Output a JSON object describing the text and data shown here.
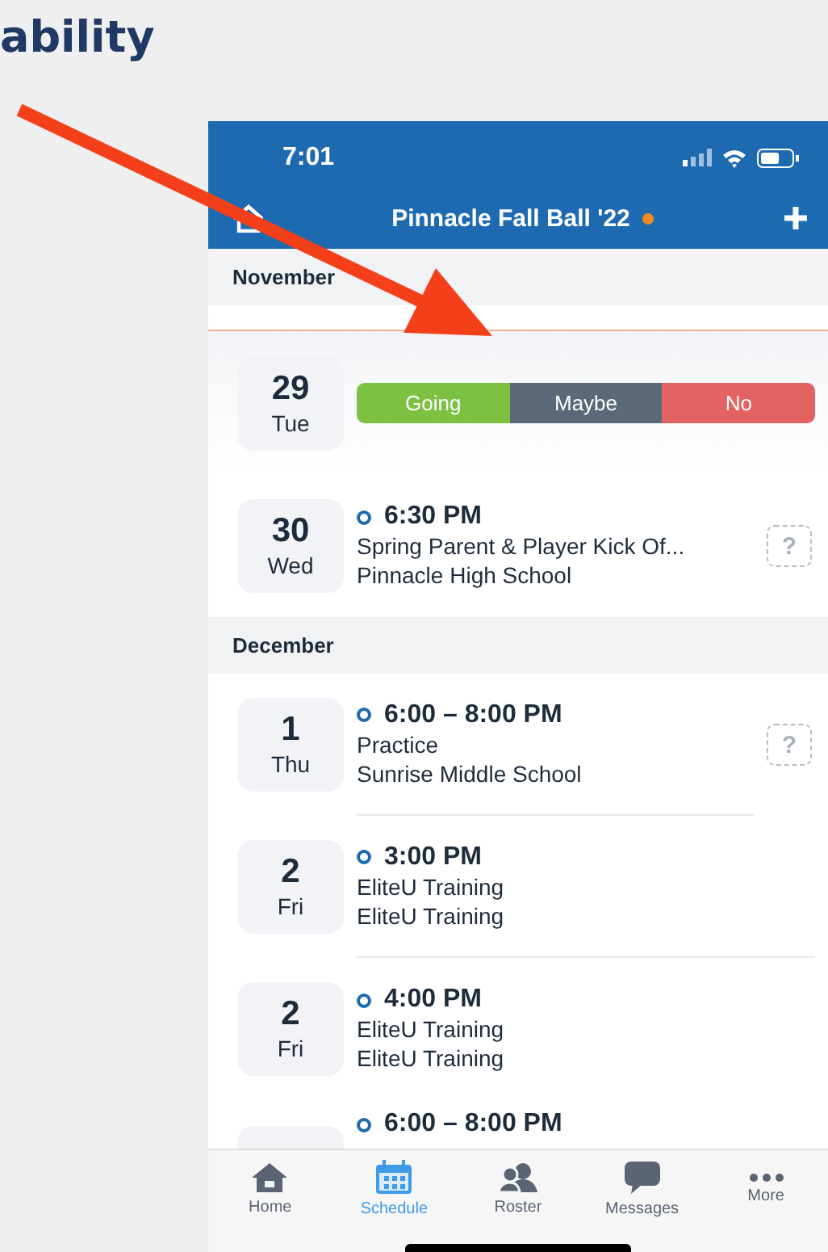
{
  "slide_title": "ability",
  "status_bar": {
    "time": "7:01"
  },
  "header": {
    "title": "Pinnacle Fall Ball '22"
  },
  "sections": [
    {
      "month": "November",
      "items": [
        {
          "kind": "prompt",
          "day": "29",
          "weekday": "Tue",
          "options": [
            {
              "label": "Going",
              "color": "#7dc142"
            },
            {
              "label": "Maybe",
              "color": "#5a6878"
            },
            {
              "label": "No",
              "color": "#e36262"
            }
          ]
        },
        {
          "kind": "event",
          "day": "30",
          "weekday": "Wed",
          "time": "6:30 PM",
          "title": "Spring Parent & Player Kick Of...",
          "location": "Pinnacle High School",
          "rsvp_badge": "?"
        }
      ]
    },
    {
      "month": "December",
      "items": [
        {
          "kind": "event",
          "day": "1",
          "weekday": "Thu",
          "time": "6:00 – 8:00 PM",
          "title": "Practice",
          "location": "Sunrise Middle School",
          "rsvp_badge": "?"
        },
        {
          "kind": "event",
          "day": "2",
          "weekday": "Fri",
          "time": "3:00 PM",
          "title": "EliteU Training",
          "location": "EliteU Training"
        },
        {
          "kind": "event",
          "day": "2",
          "weekday": "Fri",
          "time": "4:00 PM",
          "title": "EliteU Training",
          "location": "EliteU Training"
        },
        {
          "kind": "event",
          "time": "6:00 – 8:00 PM"
        }
      ]
    }
  ],
  "tabs": [
    {
      "label": "Home",
      "selected": false
    },
    {
      "label": "Schedule",
      "selected": true
    },
    {
      "label": "Roster",
      "selected": false
    },
    {
      "label": "Messages",
      "selected": false
    },
    {
      "label": "More",
      "selected": false
    }
  ]
}
